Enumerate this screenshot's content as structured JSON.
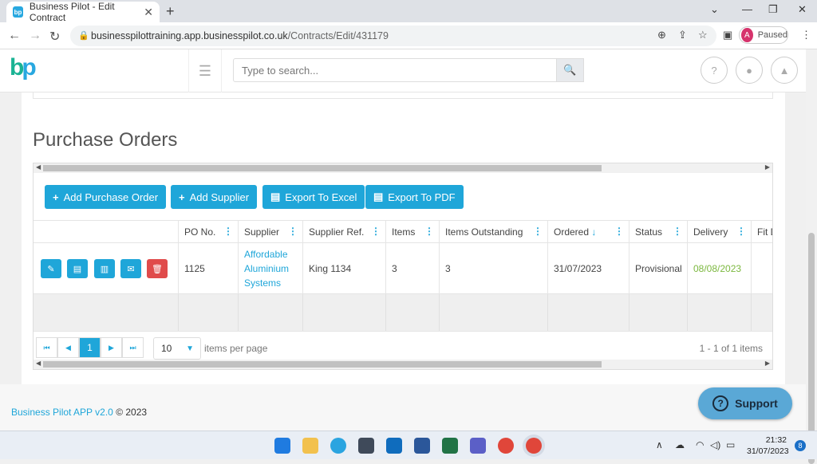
{
  "browser": {
    "tab_title": "Business Pilot - Edit Contract",
    "favicon": "bp",
    "url_host": "businesspilottraining.app.businesspilot.co.uk",
    "url_path": "/Contracts/Edit/431179",
    "profile_initial": "A",
    "profile_status": "Paused"
  },
  "header": {
    "logo": "bp",
    "search_placeholder": "Type to search..."
  },
  "section_title": "Purchase Orders",
  "toolbar": {
    "add_po": "Add Purchase Order",
    "add_supplier": "Add Supplier",
    "export_excel": "Export To Excel",
    "export_pdf": "Export To PDF"
  },
  "columns": [
    "PO No.",
    "Supplier",
    "Supplier Ref.",
    "Items",
    "Items Outstanding",
    "Ordered",
    "Status",
    "Delivery",
    "Fit D"
  ],
  "rows": [
    {
      "po_no": "1125",
      "supplier": "Affordable Aluminium Systems",
      "supplier_ref": "King 1134",
      "items": "3",
      "items_outstanding": "3",
      "ordered": "31/07/2023",
      "status": "Provisional",
      "delivery": "08/08/2023"
    }
  ],
  "pager": {
    "current_page": "1",
    "per_page": "10",
    "per_page_label": "items per page",
    "summary": "1 - 1 of 1 items"
  },
  "footer": {
    "app_link": "Business Pilot APP v2.0",
    "copyright": "© 2023"
  },
  "support_label": "Support",
  "taskbar": {
    "time": "21:32",
    "date": "31/07/2023",
    "notifications": "8"
  },
  "colors": {
    "accent": "#1fa6d9",
    "delete": "#e04b4b",
    "delivery_text": "#7cb83f"
  }
}
